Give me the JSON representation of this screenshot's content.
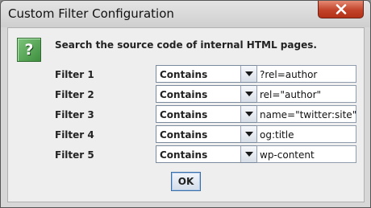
{
  "window": {
    "title": "Custom Filter Configuration"
  },
  "icons": {
    "help": "?",
    "close": "close-icon",
    "dropdown": "chevron-down-icon"
  },
  "description": "Search the source code of internal HTML pages.",
  "filters": [
    {
      "label": "Filter 1",
      "operator": "Contains",
      "value": "?rel=author"
    },
    {
      "label": "Filter 2",
      "operator": "Contains",
      "value": "rel=\"author\""
    },
    {
      "label": "Filter 3",
      "operator": "Contains",
      "value": "name=\"twitter:site\""
    },
    {
      "label": "Filter 4",
      "operator": "Contains",
      "value": "og:title"
    },
    {
      "label": "Filter 5",
      "operator": "Contains",
      "value": "wp-content"
    }
  ],
  "buttons": {
    "ok": "OK"
  },
  "colors": {
    "close": "#c2432a",
    "help_icon": "#4c9a4c",
    "focus_border": "#3c6fa8"
  }
}
